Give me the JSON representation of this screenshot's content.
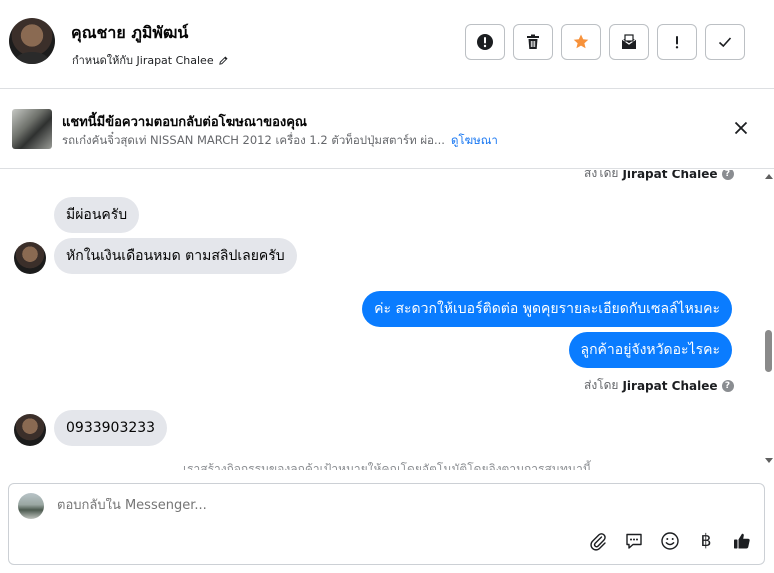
{
  "header": {
    "name": "คุณชาย ภูมิพัฒน์",
    "assigned_text": "กำหนดให้กับ Jirapat Chalee",
    "toolbar": {
      "spam_icon": "alert-circle-icon",
      "delete_icon": "trash-icon",
      "star_icon": "star-icon",
      "unread_icon": "mail-icon",
      "important_icon": "exclamation-icon",
      "done_icon": "check-icon"
    },
    "star_color": "#f7923b"
  },
  "ad_banner": {
    "title": "แชทนี้มีข้อความตอบกลับต่อโฆษณาของคุณ",
    "subtitle": "รถเก๋งคันจิ๋วสุดเท่ NISSAN MARCH 2012 เครื่อง 1.2 ตัวท็อปปุ่มสตาร์ท ผ่อ...",
    "link": "ดูโฆษณา"
  },
  "messages": {
    "sent_by_label": "ส่งโดย",
    "sender": "Jirapat Chalee",
    "items": [
      {
        "direction": "in",
        "text": "มีผ่อนครับ"
      },
      {
        "direction": "in",
        "text": "หักในเงินเดือนหมด ตามสลิปเลยครับ"
      },
      {
        "direction": "out",
        "text": "ค่ะ สะดวกให้เบอร์ติดต่อ พูดคุยรายละเอียดกับเซลล์ไหมคะ"
      },
      {
        "direction": "out",
        "text": "ลูกค้าอยู่จังหวัดอะไรคะ"
      },
      {
        "direction": "in",
        "text": "0933903233"
      }
    ],
    "notice": "เราสร้างกิจกรรมของลูกค้าเป้าหมายให้คุณโดยอัตโนมัติโดยอิงตามการสนทนานี้"
  },
  "composer": {
    "placeholder": "ตอบกลับใน Messenger...",
    "baht_symbol": "฿"
  },
  "colors": {
    "accent": "#1877f2",
    "outgoing_bubble": "#0a7cff",
    "incoming_bubble": "#e4e6eb"
  }
}
